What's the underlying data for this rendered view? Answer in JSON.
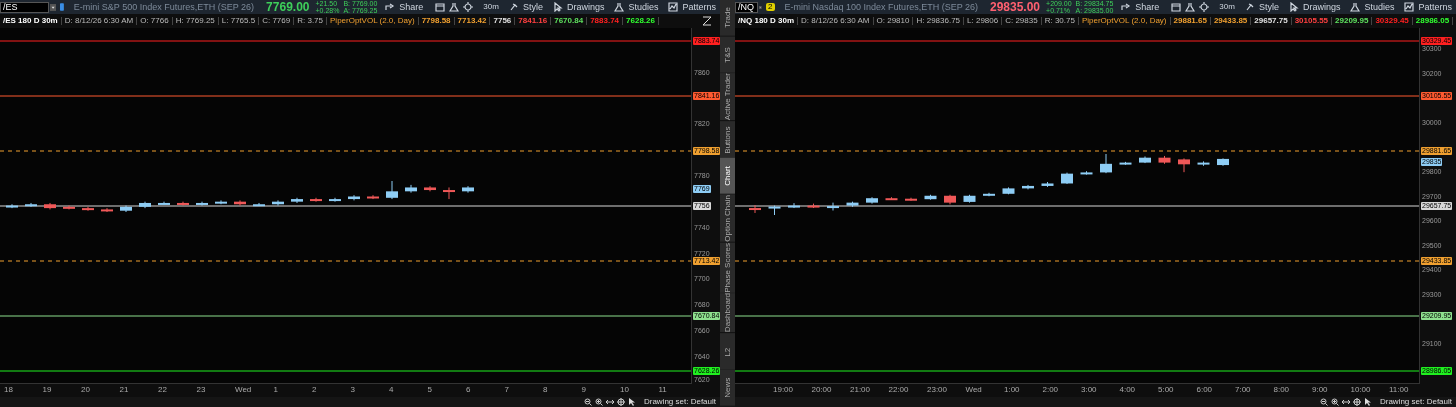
{
  "panels": [
    {
      "symbol": "/ES",
      "link": {
        "kind": "blue"
      },
      "description": "E-mini S&P 500 Index Futures,ETH (SEP 26)",
      "price": "7769.00",
      "price_up": true,
      "change": "+21.50",
      "change_pct": "+0.28%",
      "bid": "B: 7769.00",
      "ask": "A: 7769.25",
      "toolbar": [
        "Share",
        "30m",
        "Style",
        "Drawings",
        "Studies",
        "Patterns"
      ],
      "info": {
        "title": "/ES 180 D 30m",
        "fields": [
          "D: 8/12/26 6:30 AM",
          "O: 7766",
          "H: 7769.25",
          "L: 7765.5",
          "C: 7769",
          "R: 3.75"
        ],
        "study": "PiperOptVOL (2.0, Day)",
        "values": [
          {
            "text": "7798.58",
            "color": "#f0a030"
          },
          {
            "text": "7713.42",
            "color": "#f0a030"
          },
          {
            "text": "7756",
            "color": "#e0e0e0"
          },
          {
            "text": "7841.16",
            "color": "#ff4040"
          },
          {
            "text": "7670.84",
            "color": "#5ee05e"
          },
          {
            "text": "7883.74",
            "color": "#ff2020"
          },
          {
            "text": "7628.26",
            "color": "#30ff30"
          }
        ]
      },
      "levels": [
        {
          "label": "7883.74",
          "color": "#ff2020",
          "kind": "solid"
        },
        {
          "label": "7841.16",
          "color": "#ff5a30",
          "kind": "solid"
        },
        {
          "label": "7798.58",
          "color": "#f0a030",
          "kind": "dashed"
        },
        {
          "label": "7756",
          "color": "#d8d8d8",
          "kind": "solid"
        },
        {
          "label": "7713.42",
          "color": "#f0a030",
          "kind": "dashed"
        },
        {
          "label": "7670.84",
          "color": "#8ee08e",
          "kind": "solid"
        },
        {
          "label": "7628.26",
          "color": "#20f020",
          "kind": "solid"
        }
      ],
      "last_label": "7769",
      "yticks": [
        "7860",
        "7820",
        "7780",
        "7740",
        "7720",
        "7700",
        "7680",
        "7660",
        "7640",
        "7620"
      ],
      "xticks": [
        "18",
        "19",
        "20",
        "21",
        "22",
        "23",
        "Wed",
        "1",
        "2",
        "3",
        "4",
        "5",
        "6",
        "7",
        "8",
        "9",
        "10",
        "11"
      ],
      "drawing_set": "Drawing set: Default"
    },
    {
      "symbol": "/NQ",
      "link": {
        "kind": "badge",
        "text": "2"
      },
      "description": "E-mini Nasdaq 100 Index Futures,ETH (SEP 26)",
      "price": "29835.00",
      "price_up": false,
      "change": "+209.00",
      "change_pct": "+0.71%",
      "bid": "B: 29834.75",
      "ask": "A: 29835.00",
      "toolbar": [
        "Share",
        "30m",
        "Style",
        "Drawings",
        "Studies",
        "Patterns"
      ],
      "info": {
        "title": "/NQ 180 D 30m",
        "fields": [
          "D: 8/12/26 6:30 AM",
          "O: 29810",
          "H: 29836.75",
          "L: 29806",
          "C: 29835",
          "R: 30.75"
        ],
        "study": "PiperOptVOL (2.0, Day)",
        "values": [
          {
            "text": "29881.65",
            "color": "#f0a030"
          },
          {
            "text": "29433.85",
            "color": "#f0a030"
          },
          {
            "text": "29657.75",
            "color": "#e0e0e0"
          },
          {
            "text": "30105.55",
            "color": "#ff4040"
          },
          {
            "text": "29209.95",
            "color": "#5ee05e"
          },
          {
            "text": "30329.45",
            "color": "#ff2020"
          },
          {
            "text": "28986.05",
            "color": "#30ff30"
          }
        ]
      },
      "levels": [
        {
          "label": "30329.45",
          "color": "#ff2020",
          "kind": "solid"
        },
        {
          "label": "30105.55",
          "color": "#ff5a30",
          "kind": "solid"
        },
        {
          "label": "29881.65",
          "color": "#f0a030",
          "kind": "dashed"
        },
        {
          "label": "29657.75",
          "color": "#d8d8d8",
          "kind": "solid"
        },
        {
          "label": "29433.85",
          "color": "#f0a030",
          "kind": "dashed"
        },
        {
          "label": "29209.95",
          "color": "#8ee08e",
          "kind": "solid"
        },
        {
          "label": "28986.05",
          "color": "#20f020",
          "kind": "solid"
        }
      ],
      "last_label": "29835",
      "yticks": [
        "30300",
        "30200",
        "30000",
        "29800",
        "29700",
        "29600",
        "29500",
        "29400",
        "29300",
        "29100"
      ],
      "xticks": [
        "19:00",
        "20:00",
        "21:00",
        "22:00",
        "23:00",
        "Wed",
        "1:00",
        "2:00",
        "3:00",
        "4:00",
        "5:00",
        "6:00",
        "7:00",
        "8:00",
        "9:00",
        "10:00",
        "11:00"
      ],
      "drawing_set": "Drawing set: Default"
    }
  ],
  "side_tabs": [
    {
      "label": "Trade",
      "selected": false
    },
    {
      "label": "T&S",
      "selected": false
    },
    {
      "label": "Active Trader",
      "selected": false
    },
    {
      "label": "Buttons",
      "selected": false
    },
    {
      "label": "Chart",
      "selected": true
    },
    {
      "label": "Option Chain",
      "selected": false
    },
    {
      "label": "Phase Scores",
      "selected": false
    },
    {
      "label": "Dashboard",
      "selected": false
    },
    {
      "label": "L2",
      "selected": false
    },
    {
      "label": "News",
      "selected": false
    }
  ]
}
